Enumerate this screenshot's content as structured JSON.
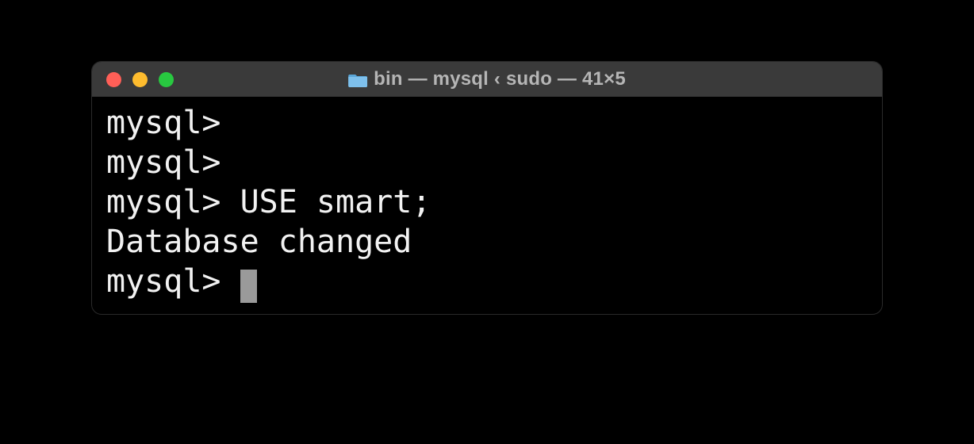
{
  "window": {
    "title": "bin — mysql ‹ sudo — 41×5"
  },
  "terminal": {
    "lines": [
      "mysql>",
      "mysql>",
      "mysql> USE smart;",
      "Database changed",
      "mysql> "
    ]
  }
}
